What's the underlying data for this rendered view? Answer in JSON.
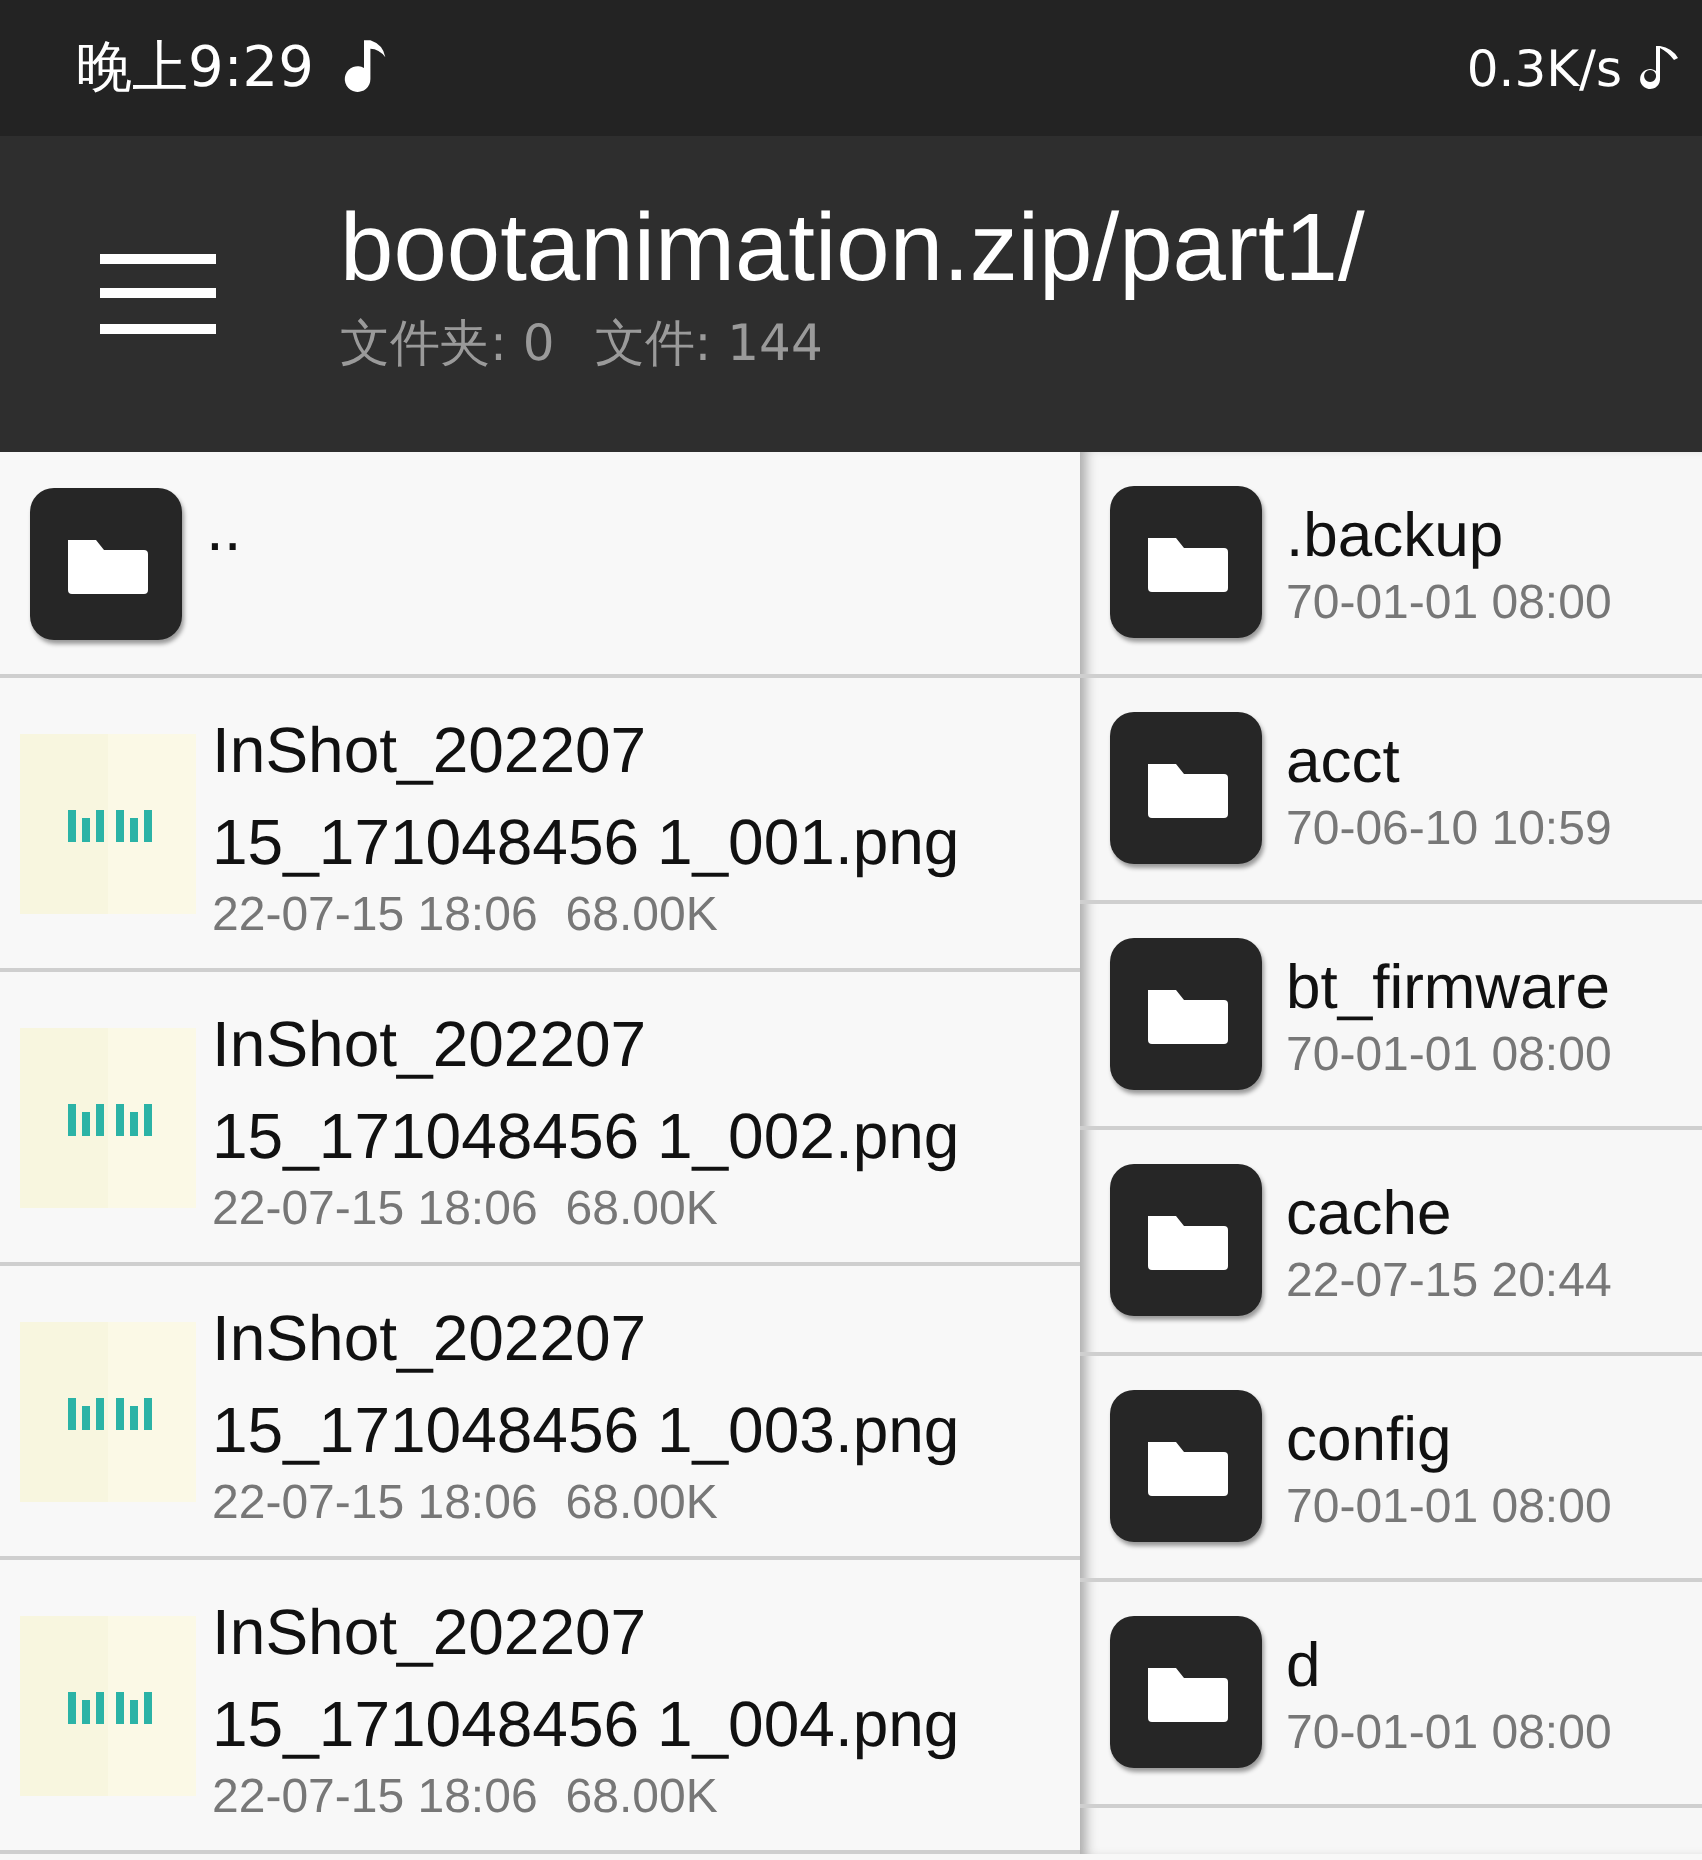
{
  "status_bar": {
    "time": "晚上9:29",
    "network_speed": "0.3K/s"
  },
  "toolbar": {
    "title": "bootanimation.zip/part1/",
    "folder_count": "文件夹: 0",
    "file_count": "文件: 144"
  },
  "left_pane": {
    "items": [
      {
        "kind": "folder",
        "name": ".."
      },
      {
        "name": "InShot_202207\n15_171048456 1_001.png",
        "date": "22-07-15 18:06",
        "size": "68.00K"
      },
      {
        "name": "InShot_202207\n15_171048456 1_002.png",
        "date": "22-07-15 18:06",
        "size": "68.00K"
      },
      {
        "name": "InShot_202207\n15_171048456 1_003.png",
        "date": "22-07-15 18:06",
        "size": "68.00K"
      },
      {
        "name": "InShot_202207\n15_171048456 1_004.png",
        "date": "22-07-15 18:06",
        "size": "68.00K"
      }
    ]
  },
  "right_pane": {
    "items": [
      {
        "kind": "folder",
        "name": ".backup",
        "date": "70-01-01 08:00"
      },
      {
        "kind": "folder",
        "name": "acct",
        "date": "70-06-10 10:59"
      },
      {
        "kind": "folder",
        "name": "bt_firmware",
        "date": "70-01-01 08:00"
      },
      {
        "kind": "folder",
        "name": "cache",
        "date": "22-07-15 20:44"
      },
      {
        "kind": "folder",
        "name": "config",
        "date": "70-01-01 08:00"
      },
      {
        "kind": "folder",
        "name": "d",
        "date": "70-01-01 08:00"
      }
    ]
  }
}
